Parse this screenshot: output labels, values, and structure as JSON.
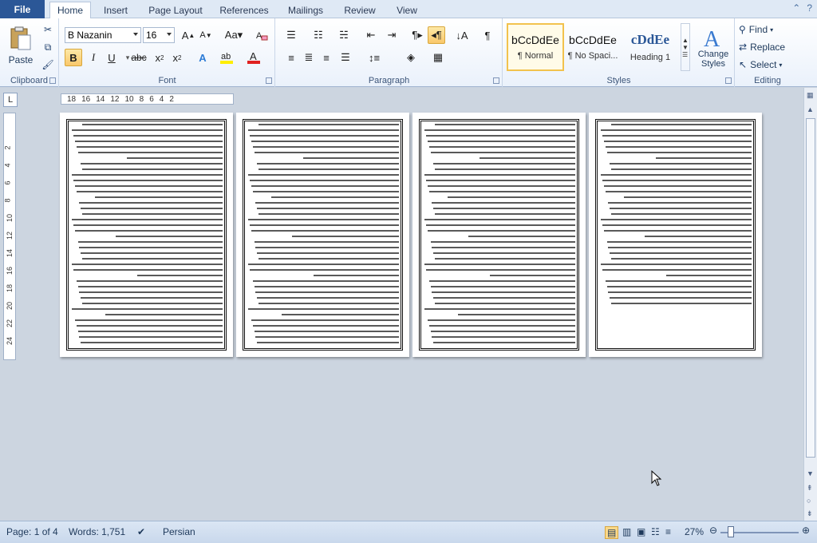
{
  "tabs": {
    "file": "File",
    "items": [
      "Home",
      "Insert",
      "Page Layout",
      "References",
      "Mailings",
      "Review",
      "View"
    ],
    "active": "Home"
  },
  "clipboard": {
    "paste": "Paste",
    "label": "Clipboard"
  },
  "font": {
    "name": "B Nazanin",
    "size": "16",
    "label": "Font"
  },
  "paragraph": {
    "label": "Paragraph"
  },
  "styles": {
    "label": "Styles",
    "items": [
      {
        "sample": "bCcDdEe",
        "name": "¶ Normal"
      },
      {
        "sample": "bCcDdEe",
        "name": "¶ No Spaci..."
      },
      {
        "sample": "cDdEe",
        "name": "Heading 1"
      }
    ],
    "change": "Change Styles"
  },
  "editing": {
    "label": "Editing",
    "find": "Find",
    "replace": "Replace",
    "select": "Select"
  },
  "ruler": {
    "h_ticks": [
      "18",
      "16",
      "14",
      "12",
      "10",
      "8",
      "6",
      "4",
      "2"
    ],
    "v_ticks": [
      "2",
      "4",
      "6",
      "8",
      "10",
      "12",
      "14",
      "16",
      "18",
      "20",
      "22",
      "24"
    ]
  },
  "status": {
    "page": "Page: 1 of 4",
    "words": "Words: 1,751",
    "language": "Persian",
    "zoom": "27%"
  }
}
